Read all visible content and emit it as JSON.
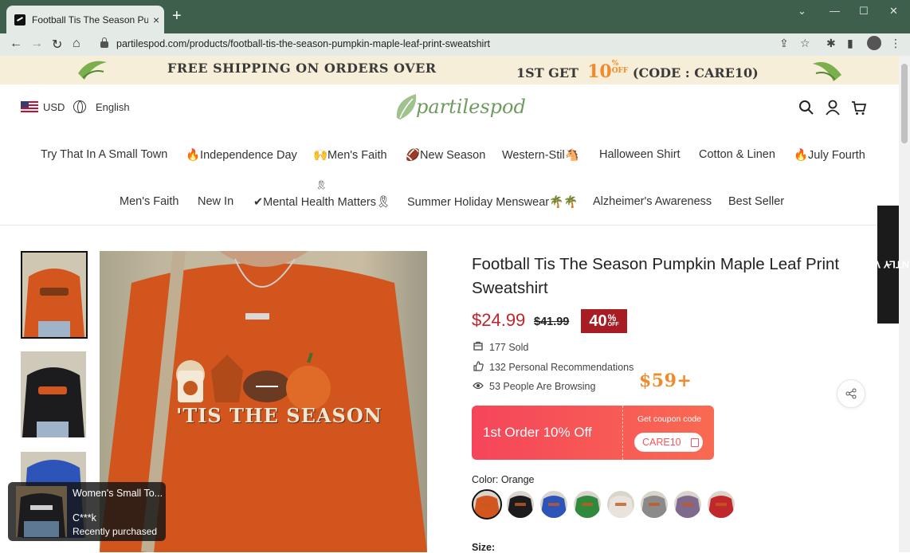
{
  "browser": {
    "tab_title": "Football Tis The Season Pumpkin",
    "tab_close": "×",
    "new_tab": "+",
    "url": "partilespod.com/products/football-tis-the-season-pumpkin-maple-leaf-print-sweatshirt"
  },
  "banner": {
    "shipping_text": "FREE SHIPPING ON ORDERS OVER",
    "shipping_amount": "$59+",
    "first_text": "1ST GET",
    "first_pct": "10",
    "first_pct_sym": "%",
    "first_off": "OFF",
    "code_text": "(CODE : CARE10)"
  },
  "header": {
    "currency": "USD",
    "language": "English",
    "logo_text": "partilespod"
  },
  "nav": {
    "row1": [
      "Try That In A Small Town",
      "🔥Independence Day",
      "🙌Men's Faith",
      "🏈New Season",
      "Western-Stil🐴",
      "Halloween Shirt",
      "Cotton & Linen",
      "🔥July Fourth"
    ],
    "row2": [
      "Men's Faith",
      "New In",
      "✔Mental Health Matters🎗",
      "Summer Holiday Menswear🌴🌴",
      "Alzheimer's Awareness",
      "Best Seller"
    ],
    "ribbon": "🎗"
  },
  "recently_viewed": "RECENTLY VIEWED",
  "product": {
    "title": "Football Tis The Season Pumpkin Maple Leaf Print Sweatshirt",
    "price": "$24.99",
    "old_price": "$41.99",
    "discount": "40",
    "discount_pct": "%",
    "discount_off": "OFF",
    "stats": [
      "177 Sold",
      "132 Personal Recommendations",
      "53 People Are Browsing"
    ],
    "coupon": {
      "headline": "1st Order 10% Off",
      "get_label": "Get coupon code",
      "code": "CARE10"
    },
    "color_label": "Color: Orange",
    "size_label": "Size:",
    "image_print": "'TIS THE SEASON",
    "colors": [
      "#d4561f",
      "#1c1c1e",
      "#2d54b8",
      "#2f8a3e",
      "#e8e3dc",
      "#8a8a8a",
      "#7f6a8e",
      "#c0282c"
    ]
  },
  "popup": {
    "product": "Women's Small To...",
    "name": "C***k",
    "status": "Recently purchased"
  }
}
